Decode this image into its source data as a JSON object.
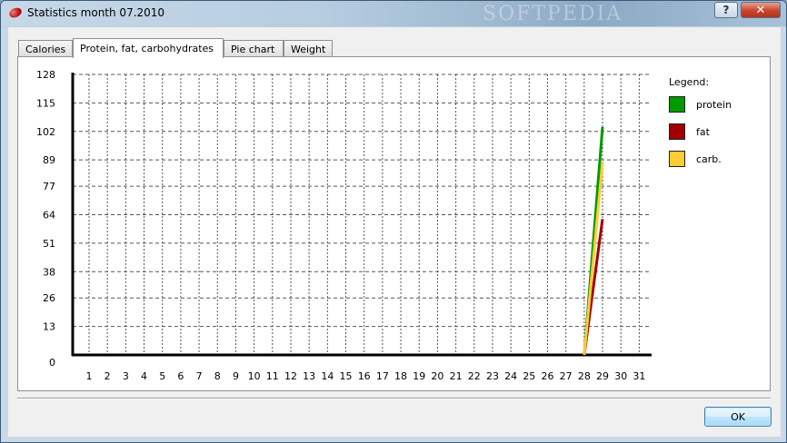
{
  "window": {
    "title": "Statistics month  07.2010",
    "watermark": "SOFTPEDIA",
    "help_label": "?",
    "close_label": "✕"
  },
  "tabs": [
    {
      "label": "Calories",
      "active": false
    },
    {
      "label": "Protein, fat, carbohydrates",
      "active": true
    },
    {
      "label": "Pie chart",
      "active": false
    },
    {
      "label": "Weight",
      "active": false
    }
  ],
  "legend": {
    "title": "Legend:",
    "items": [
      {
        "label": "protein",
        "color": "#009900"
      },
      {
        "label": "fat",
        "color": "#a00000"
      },
      {
        "label": "carb.",
        "color": "#ffcc33"
      }
    ]
  },
  "chart_data": {
    "type": "line",
    "x": [
      28,
      29
    ],
    "series": [
      {
        "name": "protein",
        "color": "#009900",
        "values": [
          0,
          104
        ]
      },
      {
        "name": "fat",
        "color": "#a00000",
        "values": [
          0,
          62
        ]
      },
      {
        "name": "carb.",
        "color": "#ffcc33",
        "values": [
          0,
          88
        ]
      }
    ],
    "x_ticks": [
      1,
      2,
      3,
      4,
      5,
      6,
      7,
      8,
      9,
      10,
      11,
      12,
      13,
      14,
      15,
      16,
      17,
      18,
      19,
      20,
      21,
      22,
      23,
      24,
      25,
      26,
      27,
      28,
      29,
      30,
      31
    ],
    "y_ticks": [
      0,
      13,
      26,
      38,
      51,
      64,
      77,
      89,
      102,
      115,
      128
    ],
    "ylim": [
      0,
      128
    ],
    "xlim": [
      1,
      31
    ],
    "grid": true,
    "legend_position": "right"
  },
  "buttons": {
    "ok_label": "OK"
  }
}
